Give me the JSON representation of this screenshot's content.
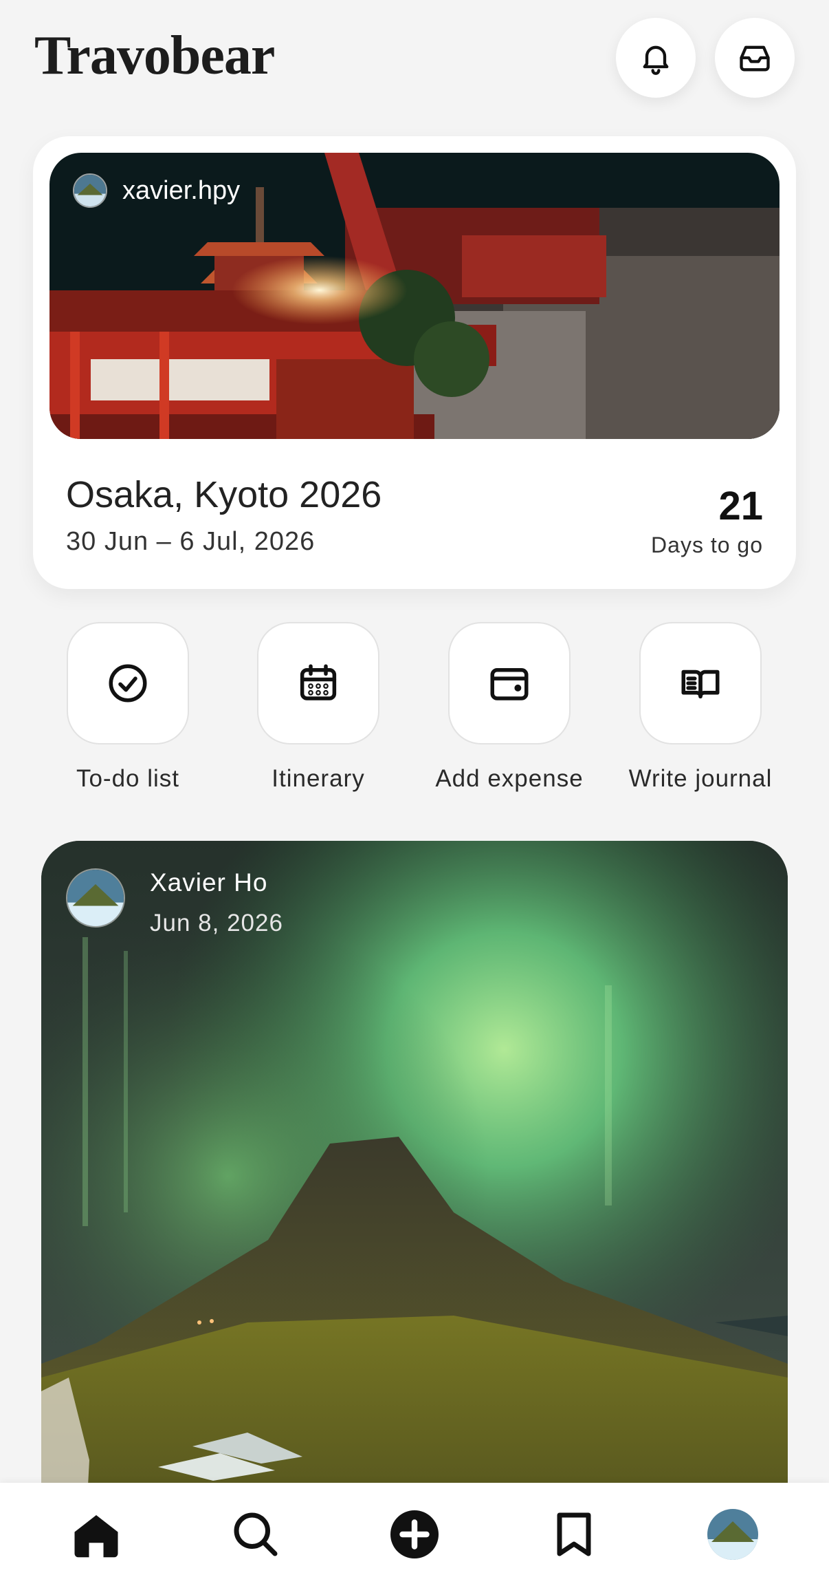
{
  "app": {
    "title": "Travobear"
  },
  "header": {
    "notifications_icon": "bell-icon",
    "inbox_icon": "inbox-tray-icon"
  },
  "trip": {
    "user": "xavier.hpy",
    "title": "Osaka, Kyoto 2026",
    "dates": "30 Jun – 6 Jul, 2026",
    "countdown_value": "21",
    "countdown_label": "Days to go"
  },
  "actions": [
    {
      "label": "To-do list",
      "icon": "check-circle-icon"
    },
    {
      "label": "Itinerary",
      "icon": "calendar-icon"
    },
    {
      "label": "Add expense",
      "icon": "wallet-icon"
    },
    {
      "label": "Write journal",
      "icon": "open-book-icon"
    }
  ],
  "post": {
    "author": "Xavier Ho",
    "date": "Jun 8, 2026"
  },
  "nav": {
    "items": [
      "home-icon",
      "search-icon",
      "plus-circle-icon",
      "bookmark-icon",
      "profile-avatar"
    ]
  },
  "colors": {
    "background": "#f4f4f4",
    "card": "#ffffff",
    "text": "#1f1f1f",
    "aurora": "#6fe08a"
  }
}
